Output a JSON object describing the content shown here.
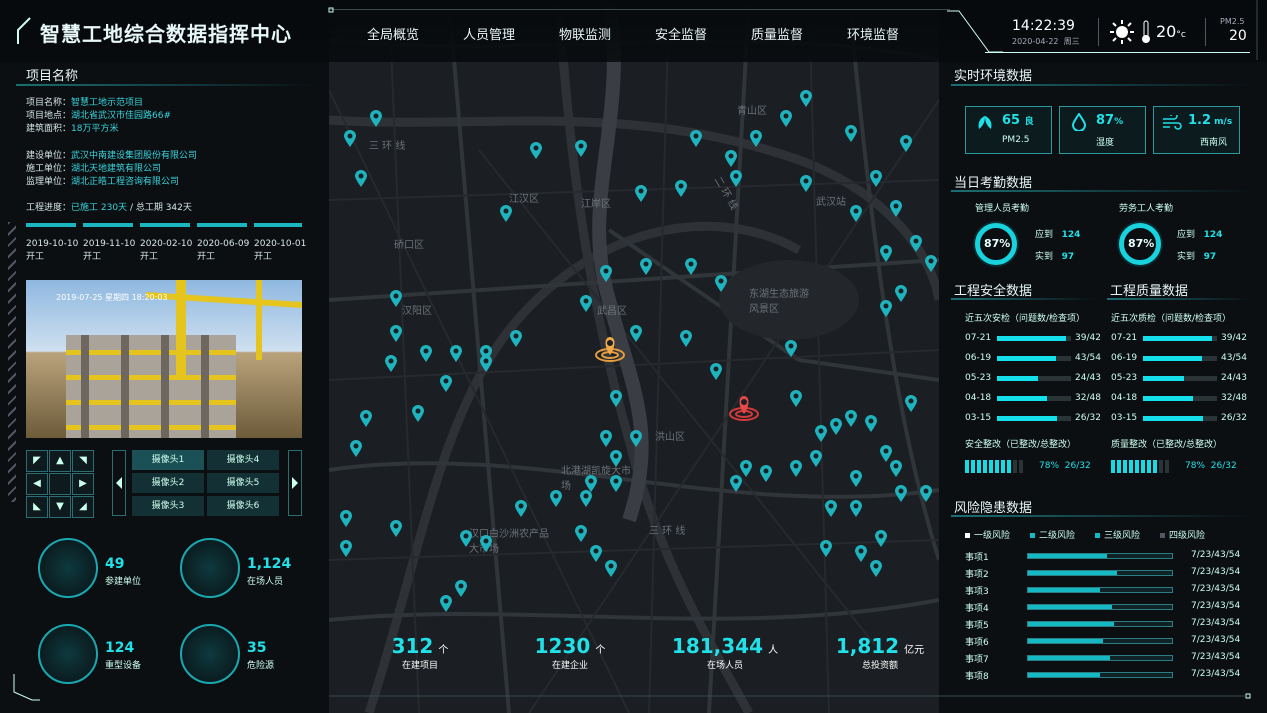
{
  "header": {
    "title": "智慧工地综合数据指挥中心",
    "nav": [
      "全局概览",
      "人员管理",
      "物联监测",
      "安全监督",
      "质量监督",
      "环境监督"
    ],
    "time": "14:22:39",
    "date": "2020-04-22",
    "weekday": "周三",
    "temp": "20",
    "temp_unit": "°c",
    "pm_label": "PM2.5",
    "pm_value": "20",
    "weather_icon": "sun-icon"
  },
  "project": {
    "section": "项目名称",
    "name_k": "项目名称：",
    "name_v": "智慧工地示范项目",
    "addr_k": "项目地点：",
    "addr_v": "湖北省武汉市佳园路66#",
    "area_k": "建筑面积：",
    "area_v": "18万平方米",
    "builder_k": "建设单位：",
    "builder_v": "武汉中南建设集团股份有限公司",
    "contractor_k": "施工单位：",
    "contractor_v": "湖北天地建筑有限公司",
    "supervisor_k": "监理单位：",
    "supervisor_v": "湖北正皓工程咨询有限公司",
    "progress_k": "工程进度：",
    "progress_v": "已施工 230天",
    "progress_total": "/ 总工期 342天",
    "milestones": [
      {
        "date": "2019-10-10",
        "label": "开工"
      },
      {
        "date": "2019-11-10",
        "label": "开工"
      },
      {
        "date": "2020-02-10",
        "label": "开工"
      },
      {
        "date": "2020-06-09",
        "label": "开工"
      },
      {
        "date": "2020-10-01",
        "label": "开工"
      }
    ],
    "camera_overlay": "2019-07-25  星期四  18:20:03"
  },
  "cameras": [
    "摄像头1",
    "摄像头4",
    "摄像头2",
    "摄像头5",
    "摄像头3",
    "摄像头6"
  ],
  "stats": [
    {
      "value": "49",
      "label": "参建单位"
    },
    {
      "value": "1,124",
      "label": "在场人员"
    },
    {
      "value": "124",
      "label": "重型设备"
    },
    {
      "value": "35",
      "label": "危险源"
    }
  ],
  "bottom": [
    {
      "value": "312",
      "unit": "个",
      "label": "在建项目"
    },
    {
      "value": "1230",
      "unit": "个",
      "label": "在建企业"
    },
    {
      "value": "181,344",
      "unit": "人",
      "label": "在场人员"
    },
    {
      "value": "1,812",
      "unit": "亿元",
      "label": "总投资额"
    }
  ],
  "env": {
    "section": "实时环境数据",
    "pm": {
      "value": "65",
      "grade": "良",
      "label": "PM2.5"
    },
    "humidity": {
      "value": "87",
      "unit": "%",
      "label": "湿度"
    },
    "wind": {
      "value": "1.2",
      "unit": "m/s",
      "label": "西南风"
    }
  },
  "attendance": {
    "section": "当日考勤数据",
    "mgr": {
      "title": "管理人员考勤",
      "pct": "87%",
      "due_k": "应到",
      "due_v": "124",
      "act_k": "实到",
      "act_v": "97"
    },
    "worker": {
      "title": "劳务工人考勤",
      "pct": "87%",
      "due_k": "应到",
      "due_v": "124",
      "act_k": "实到",
      "act_v": "97"
    }
  },
  "safety": {
    "section": "工程安全数据",
    "sub": "近五次安检（问题数/检查项）",
    "rows": [
      {
        "date": "07-21",
        "v": "39/42",
        "r": 0.93
      },
      {
        "date": "06-19",
        "v": "43/54",
        "r": 0.8
      },
      {
        "date": "05-23",
        "v": "24/43",
        "r": 0.56
      },
      {
        "date": "04-18",
        "v": "32/48",
        "r": 0.67
      },
      {
        "date": "03-15",
        "v": "26/32",
        "r": 0.81
      }
    ],
    "fix_label": "安全整改（已整改/总整改）",
    "fix_pct": "78%",
    "fix_v": "26/32"
  },
  "quality": {
    "section": "工程质量数据",
    "sub": "近五次质检（问题数/检查项）",
    "rows": [
      {
        "date": "07-21",
        "v": "39/42",
        "r": 0.93
      },
      {
        "date": "06-19",
        "v": "43/54",
        "r": 0.8
      },
      {
        "date": "05-23",
        "v": "24/43",
        "r": 0.56
      },
      {
        "date": "04-18",
        "v": "32/48",
        "r": 0.67
      },
      {
        "date": "03-15",
        "v": "26/32",
        "r": 0.81
      }
    ],
    "fix_label": "质量整改（已整改/总整改）",
    "fix_pct": "78%",
    "fix_v": "26/32"
  },
  "risk": {
    "section": "风险隐患数据",
    "legend": [
      "一级风险",
      "二级风险",
      "三级风险",
      "四级风险"
    ],
    "rows": [
      {
        "name": "事项1",
        "t": "7/23/43/54",
        "r": 0.55
      },
      {
        "name": "事项2",
        "t": "7/23/43/54",
        "r": 0.62
      },
      {
        "name": "事项3",
        "t": "7/23/43/54",
        "r": 0.5
      },
      {
        "name": "事项4",
        "t": "7/23/43/54",
        "r": 0.58
      },
      {
        "name": "事项5",
        "t": "7/23/43/54",
        "r": 0.6
      },
      {
        "name": "事项6",
        "t": "7/23/43/54",
        "r": 0.52
      },
      {
        "name": "事项7",
        "t": "7/23/43/54",
        "r": 0.57
      },
      {
        "name": "事项8",
        "t": "7/23/43/54",
        "r": 0.5
      }
    ]
  },
  "map": {
    "labels": [
      "青山区",
      "江汉区",
      "江岸区",
      "武汉站",
      "硚口区",
      "汉阳区",
      "武昌区",
      "洪山区",
      "东湖生态旅游风景区",
      "北港湖凯旋大市场",
      "汉口白沙洲农产品大市场",
      "三 环 线",
      "三 环 线",
      "二 环 线"
    ]
  }
}
